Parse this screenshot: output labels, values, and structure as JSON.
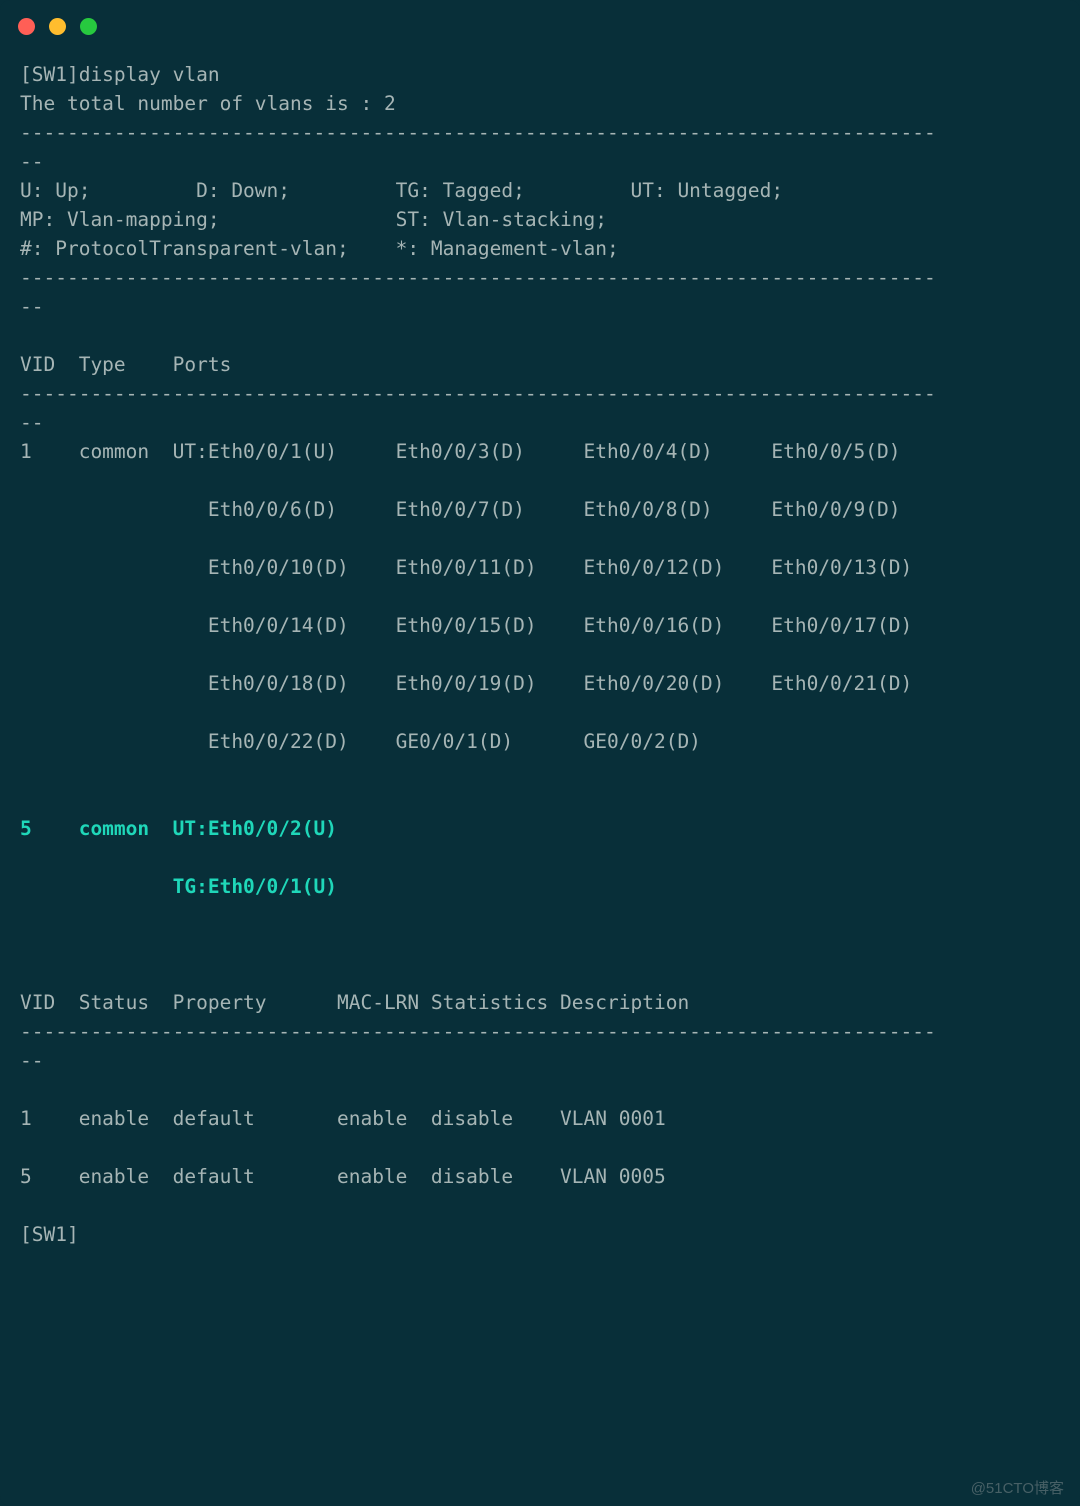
{
  "window": {
    "traffic": {
      "red": "close-icon",
      "yellow": "minimize-icon",
      "green": "zoom-icon"
    }
  },
  "term": {
    "l01": "[SW1]display vlan",
    "l02": "The total number of vlans is : 2",
    "l03": "------------------------------------------------------------------------------",
    "l04": "--",
    "l05": "U: Up;         D: Down;         TG: Tagged;         UT: Untagged;",
    "l06": "MP: Vlan-mapping;               ST: Vlan-stacking;",
    "l07": "#: ProtocolTransparent-vlan;    *: Management-vlan;",
    "l08": "------------------------------------------------------------------------------",
    "l09": "--",
    "l10": "",
    "l11": "VID  Type    Ports",
    "l12": "------------------------------------------------------------------------------",
    "l13": "--",
    "l14": "1    common  UT:Eth0/0/1(U)     Eth0/0/3(D)     Eth0/0/4(D)     Eth0/0/5(D)",
    "l15": "",
    "l16": "                Eth0/0/6(D)     Eth0/0/7(D)     Eth0/0/8(D)     Eth0/0/9(D)",
    "l17": "",
    "l18": "                Eth0/0/10(D)    Eth0/0/11(D)    Eth0/0/12(D)    Eth0/0/13(D)",
    "l19": "",
    "l20": "                Eth0/0/14(D)    Eth0/0/15(D)    Eth0/0/16(D)    Eth0/0/17(D)",
    "l21": "",
    "l22": "                Eth0/0/18(D)    Eth0/0/19(D)    Eth0/0/20(D)    Eth0/0/21(D)",
    "l23": "",
    "l24": "                Eth0/0/22(D)    GE0/0/1(D)      GE0/0/2(D)",
    "l25": "",
    "l26": "",
    "hl1": "5    common  UT:Eth0/0/2(U)",
    "l27": "",
    "hl2": "             TG:Eth0/0/1(U)",
    "l28": "",
    "l29": "",
    "l30": "",
    "l31": "VID  Status  Property      MAC-LRN Statistics Description",
    "l32": "------------------------------------------------------------------------------",
    "l33": "--",
    "l34": "",
    "l35": "1    enable  default       enable  disable    VLAN 0001",
    "l36": "",
    "l37": "5    enable  default       enable  disable    VLAN 0005",
    "l38": "",
    "l39": "[SW1]"
  },
  "watermark": "@51CTO博客"
}
